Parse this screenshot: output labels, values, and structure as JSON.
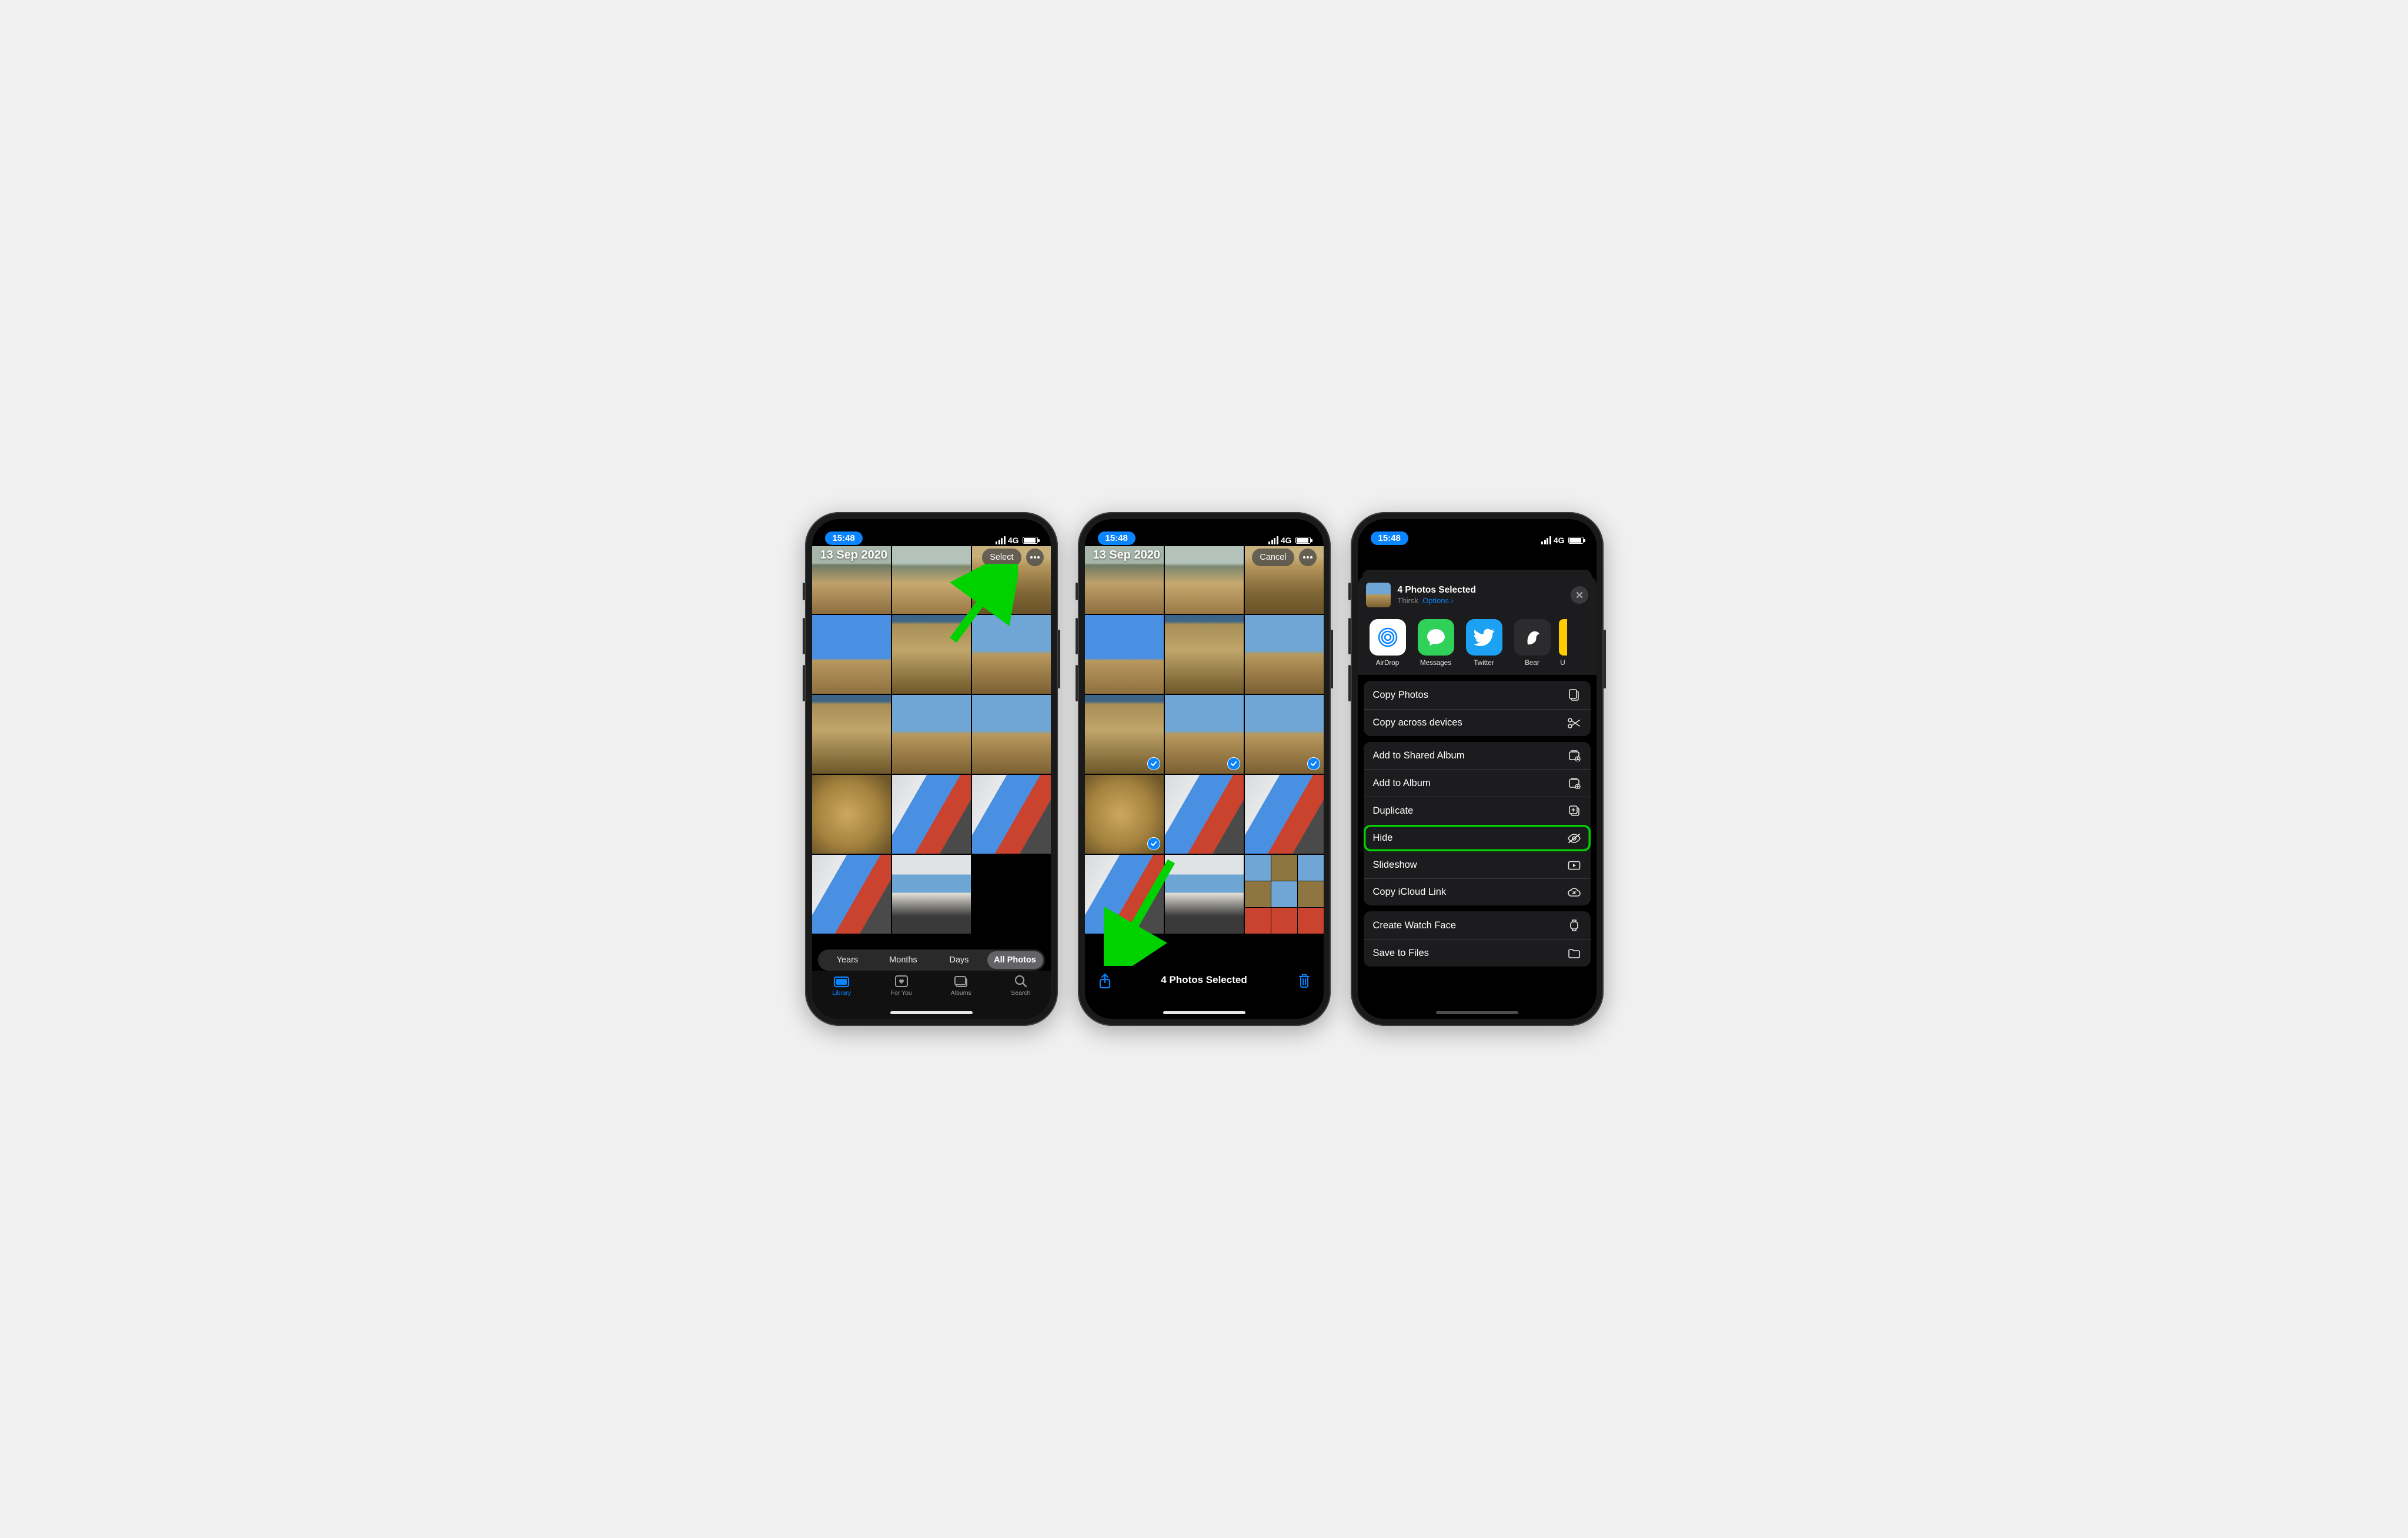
{
  "status": {
    "time": "15:48",
    "network": "4G"
  },
  "phone1": {
    "date_header": "13 Sep 2020",
    "select_label": "Select",
    "segmented": {
      "years": "Years",
      "months": "Months",
      "days": "Days",
      "all": "All Photos"
    },
    "tabs": {
      "library": "Library",
      "for_you": "For You",
      "albums": "Albums",
      "search": "Search"
    }
  },
  "phone2": {
    "date_header": "13 Sep 2020",
    "cancel_label": "Cancel",
    "selection_text": "4 Photos Selected"
  },
  "phone3": {
    "sheet_title": "4 Photos Selected",
    "location": "Thirsk",
    "options_label": "Options",
    "apps": {
      "airdrop": "AirDrop",
      "messages": "Messages",
      "twitter": "Twitter",
      "bear": "Bear",
      "partial": "U"
    },
    "actions": {
      "copy_photos": "Copy Photos",
      "copy_across": "Copy across devices",
      "add_shared": "Add to Shared Album",
      "add_album": "Add to Album",
      "duplicate": "Duplicate",
      "hide": "Hide",
      "slideshow": "Slideshow",
      "icloud_link": "Copy iCloud Link",
      "watch_face": "Create Watch Face",
      "save_files": "Save to Files"
    }
  }
}
